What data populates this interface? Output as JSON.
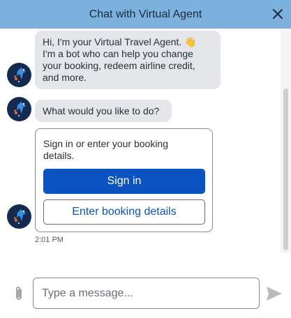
{
  "header": {
    "title": "Chat with Virtual Agent",
    "close_icon": "close-icon",
    "background_color": "#7cb0dd"
  },
  "messages": [
    {
      "lines": [
        "Hi, I'm your Virtual Travel Agent. 👋",
        "I'm a bot who can help you change",
        "your booking, redeem airline credit,",
        "and more."
      ]
    },
    {
      "lines": [
        "What would you like to do?"
      ]
    }
  ],
  "card": {
    "lines": [
      "Sign in or enter your booking",
      "details."
    ],
    "primary_button": "Sign in",
    "secondary_button": "Enter booking details"
  },
  "timestamp": "2:01 PM",
  "composer": {
    "placeholder": "Type a message...",
    "attach_icon": "paperclip-icon",
    "send_icon": "send-icon"
  },
  "colors": {
    "accent": "#0b53c0",
    "bubble": "#e4e6ea",
    "avatar": "#142a4f"
  }
}
